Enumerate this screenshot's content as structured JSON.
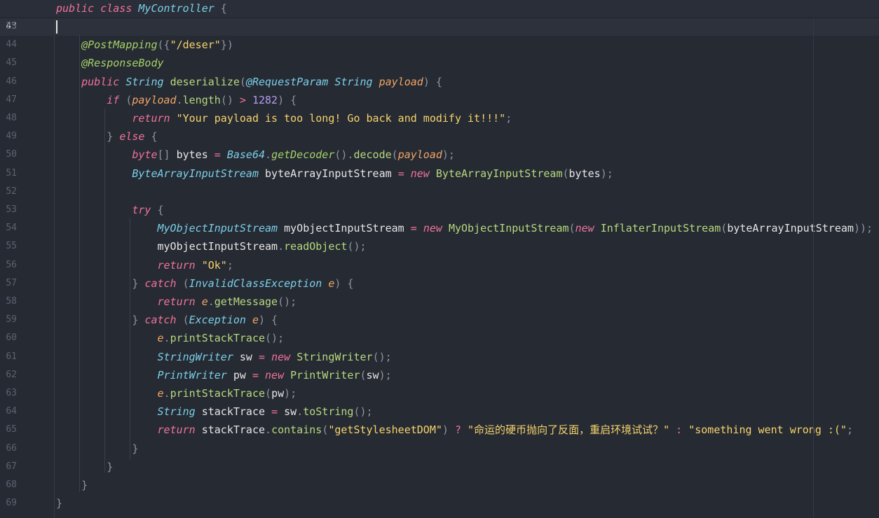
{
  "sticky": {
    "line_no": "25",
    "tokens": [
      {
        "t": "public class ",
        "c": "kw"
      },
      {
        "t": "MyController",
        "c": "ty"
      },
      {
        "t": " {",
        "c": "pu"
      }
    ]
  },
  "lines": [
    {
      "no": "43",
      "current": true,
      "tokens": []
    },
    {
      "no": "44",
      "tokens": [
        {
          "t": "    "
        },
        {
          "t": "@PostMapping",
          "c": "an"
        },
        {
          "t": "({",
          "c": "pu"
        },
        {
          "t": "\"/deser\"",
          "c": "st"
        },
        {
          "t": "})",
          "c": "pu"
        }
      ]
    },
    {
      "no": "45",
      "tokens": [
        {
          "t": "    "
        },
        {
          "t": "@ResponseBody",
          "c": "an"
        }
      ]
    },
    {
      "no": "46",
      "tokens": [
        {
          "t": "    "
        },
        {
          "t": "public ",
          "c": "kw"
        },
        {
          "t": "String ",
          "c": "ty"
        },
        {
          "t": "deserialize",
          "c": "fn"
        },
        {
          "t": "(",
          "c": "pu"
        },
        {
          "t": "@RequestParam ",
          "c": "ty"
        },
        {
          "t": "String ",
          "c": "ty"
        },
        {
          "t": "payload",
          "c": "pa"
        },
        {
          "t": ") {",
          "c": "pu"
        }
      ]
    },
    {
      "no": "47",
      "tokens": [
        {
          "t": "        "
        },
        {
          "t": "if ",
          "c": "kw"
        },
        {
          "t": "(",
          "c": "pu"
        },
        {
          "t": "payload",
          "c": "pa"
        },
        {
          "t": ".",
          "c": "pu"
        },
        {
          "t": "length",
          "c": "fn"
        },
        {
          "t": "() ",
          "c": "pu"
        },
        {
          "t": "> ",
          "c": "op"
        },
        {
          "t": "1282",
          "c": "nu"
        },
        {
          "t": ") {",
          "c": "pu"
        }
      ]
    },
    {
      "no": "48",
      "tokens": [
        {
          "t": "            "
        },
        {
          "t": "return ",
          "c": "kw"
        },
        {
          "t": "\"Your payload is too long! Go back and modify it!!!\"",
          "c": "st"
        },
        {
          "t": ";",
          "c": "pu"
        }
      ]
    },
    {
      "no": "49",
      "tokens": [
        {
          "t": "        "
        },
        {
          "t": "} ",
          "c": "pu"
        },
        {
          "t": "else",
          "c": "kw"
        },
        {
          "t": " {",
          "c": "pu"
        }
      ]
    },
    {
      "no": "50",
      "tokens": [
        {
          "t": "            "
        },
        {
          "t": "byte",
          "c": "kw"
        },
        {
          "t": "[] ",
          "c": "pu"
        },
        {
          "t": "bytes ",
          "c": "va"
        },
        {
          "t": "= ",
          "c": "op"
        },
        {
          "t": "Base64",
          "c": "ty"
        },
        {
          "t": ".",
          "c": "pu"
        },
        {
          "t": "getDecoder",
          "c": "an"
        },
        {
          "t": "().",
          "c": "pu"
        },
        {
          "t": "decode",
          "c": "fn"
        },
        {
          "t": "(",
          "c": "pu"
        },
        {
          "t": "payload",
          "c": "pa"
        },
        {
          "t": ");",
          "c": "pu"
        }
      ]
    },
    {
      "no": "51",
      "tokens": [
        {
          "t": "            "
        },
        {
          "t": "ByteArrayInputStream ",
          "c": "ty"
        },
        {
          "t": "byteArrayInputStream ",
          "c": "va"
        },
        {
          "t": "= ",
          "c": "op"
        },
        {
          "t": "new ",
          "c": "kw"
        },
        {
          "t": "ByteArrayInputStream",
          "c": "fn"
        },
        {
          "t": "(",
          "c": "pu"
        },
        {
          "t": "bytes",
          "c": "va"
        },
        {
          "t": ");",
          "c": "pu"
        }
      ]
    },
    {
      "no": "52",
      "tokens": []
    },
    {
      "no": "53",
      "tokens": [
        {
          "t": "            "
        },
        {
          "t": "try",
          "c": "kw"
        },
        {
          "t": " {",
          "c": "pu"
        }
      ]
    },
    {
      "no": "54",
      "tokens": [
        {
          "t": "                "
        },
        {
          "t": "MyObjectInputStream ",
          "c": "ty"
        },
        {
          "t": "myObjectInputStream ",
          "c": "va"
        },
        {
          "t": "= ",
          "c": "op"
        },
        {
          "t": "new ",
          "c": "kw"
        },
        {
          "t": "MyObjectInputStream",
          "c": "fn"
        },
        {
          "t": "(",
          "c": "pu"
        },
        {
          "t": "new ",
          "c": "kw"
        },
        {
          "t": "InflaterInputStream",
          "c": "fn"
        },
        {
          "t": "(",
          "c": "pu"
        },
        {
          "t": "byteArrayInputStream",
          "c": "va"
        },
        {
          "t": "));",
          "c": "pu"
        }
      ]
    },
    {
      "no": "55",
      "tokens": [
        {
          "t": "                "
        },
        {
          "t": "myObjectInputStream",
          "c": "va"
        },
        {
          "t": ".",
          "c": "pu"
        },
        {
          "t": "readObject",
          "c": "fn"
        },
        {
          "t": "();",
          "c": "pu"
        }
      ]
    },
    {
      "no": "56",
      "tokens": [
        {
          "t": "                "
        },
        {
          "t": "return ",
          "c": "kw"
        },
        {
          "t": "\"Ok\"",
          "c": "st"
        },
        {
          "t": ";",
          "c": "pu"
        }
      ]
    },
    {
      "no": "57",
      "tokens": [
        {
          "t": "            "
        },
        {
          "t": "} ",
          "c": "pu"
        },
        {
          "t": "catch ",
          "c": "kw"
        },
        {
          "t": "(",
          "c": "pu"
        },
        {
          "t": "InvalidClassException ",
          "c": "ty"
        },
        {
          "t": "e",
          "c": "pa"
        },
        {
          "t": ") {",
          "c": "pu"
        }
      ]
    },
    {
      "no": "58",
      "tokens": [
        {
          "t": "                "
        },
        {
          "t": "return ",
          "c": "kw"
        },
        {
          "t": "e",
          "c": "pa"
        },
        {
          "t": ".",
          "c": "pu"
        },
        {
          "t": "getMessage",
          "c": "fn"
        },
        {
          "t": "();",
          "c": "pu"
        }
      ]
    },
    {
      "no": "59",
      "tokens": [
        {
          "t": "            "
        },
        {
          "t": "} ",
          "c": "pu"
        },
        {
          "t": "catch ",
          "c": "kw"
        },
        {
          "t": "(",
          "c": "pu"
        },
        {
          "t": "Exception ",
          "c": "ty"
        },
        {
          "t": "e",
          "c": "pa"
        },
        {
          "t": ") {",
          "c": "pu"
        }
      ]
    },
    {
      "no": "60",
      "tokens": [
        {
          "t": "                "
        },
        {
          "t": "e",
          "c": "pa"
        },
        {
          "t": ".",
          "c": "pu"
        },
        {
          "t": "printStackTrace",
          "c": "fn"
        },
        {
          "t": "();",
          "c": "pu"
        }
      ]
    },
    {
      "no": "61",
      "tokens": [
        {
          "t": "                "
        },
        {
          "t": "StringWriter ",
          "c": "ty"
        },
        {
          "t": "sw ",
          "c": "va"
        },
        {
          "t": "= ",
          "c": "op"
        },
        {
          "t": "new ",
          "c": "kw"
        },
        {
          "t": "StringWriter",
          "c": "fn"
        },
        {
          "t": "();",
          "c": "pu"
        }
      ]
    },
    {
      "no": "62",
      "tokens": [
        {
          "t": "                "
        },
        {
          "t": "PrintWriter ",
          "c": "ty"
        },
        {
          "t": "pw ",
          "c": "va"
        },
        {
          "t": "= ",
          "c": "op"
        },
        {
          "t": "new ",
          "c": "kw"
        },
        {
          "t": "PrintWriter",
          "c": "fn"
        },
        {
          "t": "(",
          "c": "pu"
        },
        {
          "t": "sw",
          "c": "va"
        },
        {
          "t": ");",
          "c": "pu"
        }
      ]
    },
    {
      "no": "63",
      "tokens": [
        {
          "t": "                "
        },
        {
          "t": "e",
          "c": "pa"
        },
        {
          "t": ".",
          "c": "pu"
        },
        {
          "t": "printStackTrace",
          "c": "fn"
        },
        {
          "t": "(",
          "c": "pu"
        },
        {
          "t": "pw",
          "c": "va"
        },
        {
          "t": ");",
          "c": "pu"
        }
      ]
    },
    {
      "no": "64",
      "tokens": [
        {
          "t": "                "
        },
        {
          "t": "String ",
          "c": "ty"
        },
        {
          "t": "stackTrace ",
          "c": "va"
        },
        {
          "t": "= ",
          "c": "op"
        },
        {
          "t": "sw",
          "c": "va"
        },
        {
          "t": ".",
          "c": "pu"
        },
        {
          "t": "toString",
          "c": "fn"
        },
        {
          "t": "();",
          "c": "pu"
        }
      ]
    },
    {
      "no": "65",
      "tokens": [
        {
          "t": "                "
        },
        {
          "t": "return ",
          "c": "kw"
        },
        {
          "t": "stackTrace",
          "c": "va"
        },
        {
          "t": ".",
          "c": "pu"
        },
        {
          "t": "contains",
          "c": "fn"
        },
        {
          "t": "(",
          "c": "pu"
        },
        {
          "t": "\"getStylesheetDOM\"",
          "c": "st"
        },
        {
          "t": ") ",
          "c": "pu"
        },
        {
          "t": "? ",
          "c": "op"
        },
        {
          "t": "\"命运的硬币抛向了反面，重启环境试试？\"",
          "c": "st"
        },
        {
          "t": " : ",
          "c": "op"
        },
        {
          "t": "\"something went wrong :(\"",
          "c": "st"
        },
        {
          "t": ";",
          "c": "pu"
        }
      ]
    },
    {
      "no": "66",
      "tokens": [
        {
          "t": "            "
        },
        {
          "t": "}",
          "c": "pu"
        }
      ]
    },
    {
      "no": "67",
      "tokens": [
        {
          "t": "        "
        },
        {
          "t": "}",
          "c": "pu"
        }
      ]
    },
    {
      "no": "68",
      "tokens": [
        {
          "t": "    "
        },
        {
          "t": "}",
          "c": "pu"
        }
      ]
    },
    {
      "no": "69",
      "tokens": [
        {
          "t": "}",
          "c": "pu"
        }
      ]
    }
  ]
}
